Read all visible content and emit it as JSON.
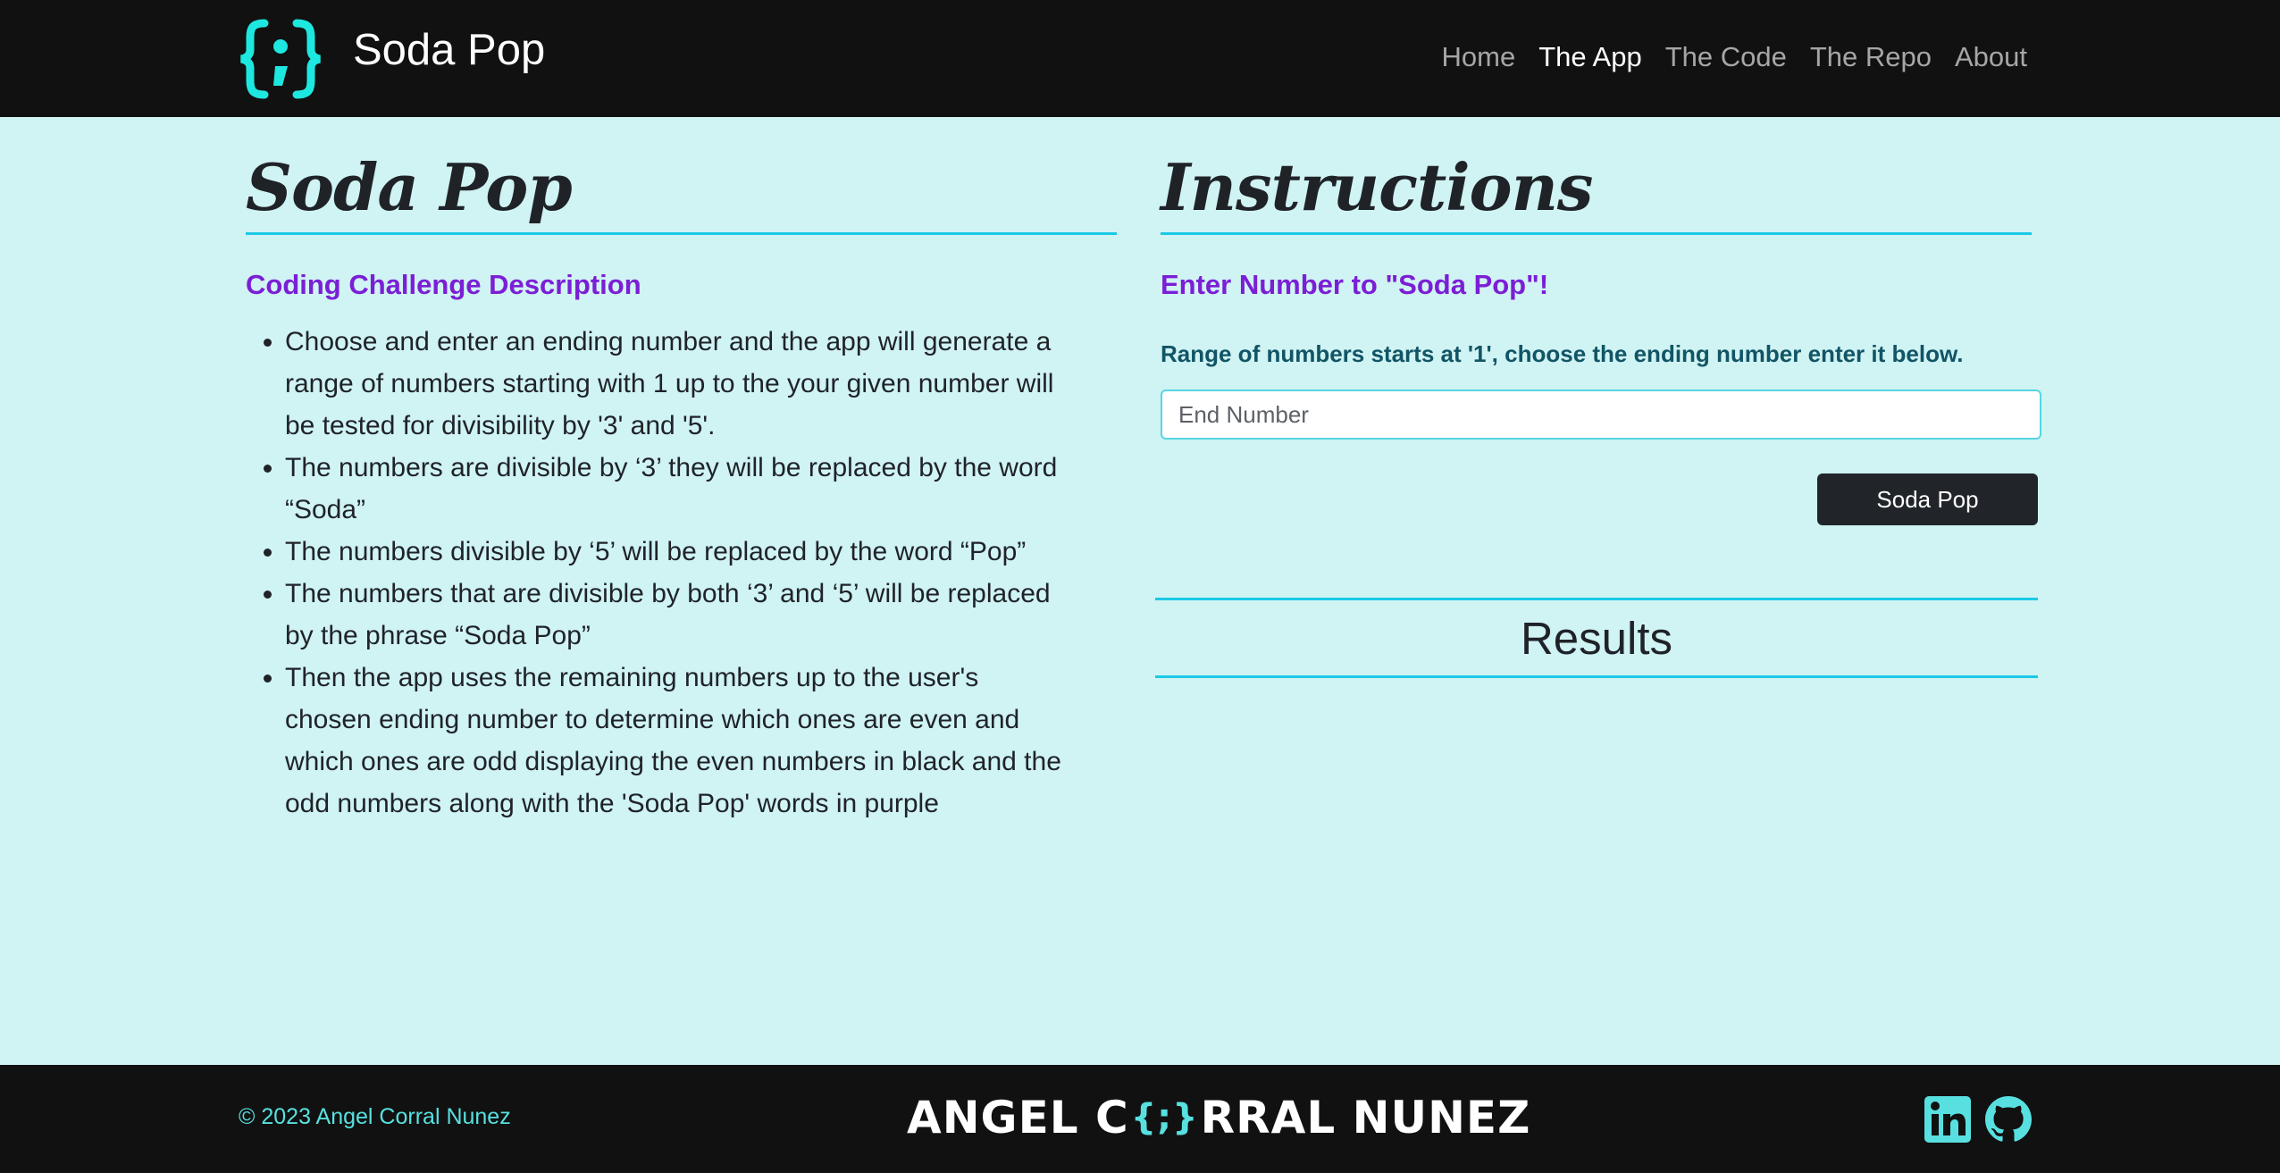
{
  "brand": {
    "name": "Soda Pop",
    "logo_icon": "curly-brace-semicolon-icon"
  },
  "nav": {
    "items": [
      "Home",
      "The App",
      "The Code",
      "The Repo",
      "About"
    ],
    "active": "The App"
  },
  "left": {
    "title": "Soda Pop",
    "subtitle": "Coding Challenge Description",
    "bullets": [
      "Choose and enter an ending number and the app will generate a range of numbers starting with 1 up to the your given number will be tested for divisibility by '3' and '5'.",
      "The numbers are divisible by ‘3’ they will be replaced by the word “Soda”",
      "The numbers divisible by ‘5’ will be replaced by the word “Pop”",
      "The numbers that are divisible by both ‘3’ and ‘5’ will be replaced by the phrase “Soda Pop”",
      "Then the app uses the remaining numbers up to the user's chosen ending number to determine which ones are even and which ones are odd displaying the even numbers in black and the odd numbers along with the 'Soda Pop' words in purple"
    ]
  },
  "right": {
    "title": "Instructions",
    "subtitle": "Enter Number to \"Soda Pop\"!",
    "range_text": "Range of numbers starts at '1', choose the ending number enter it below.",
    "input": {
      "placeholder": "End Number",
      "value": ""
    },
    "button_label": "Soda Pop",
    "results_title": "Results"
  },
  "footer": {
    "copyright": "© 2023 Angel Corral Nunez",
    "brand_pre": "ANGEL C",
    "brand_brace": "{;}",
    "brand_post": "RRAL NUNEZ",
    "icons": [
      "linkedin-icon",
      "github-icon"
    ]
  },
  "colors": {
    "accent": "#1ac9e6",
    "purple": "#7b1fd6",
    "teal": "#58e0e0",
    "background": "#d0f3f3",
    "dark": "#111111"
  }
}
